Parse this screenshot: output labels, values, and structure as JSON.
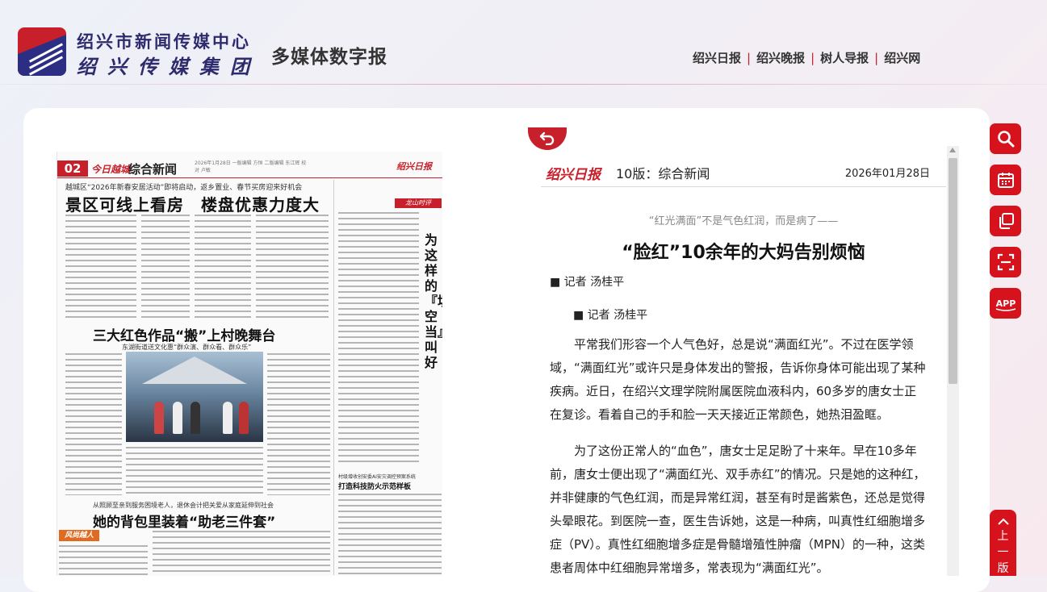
{
  "header": {
    "org_name": "绍兴市新闻传媒中心",
    "org_group": "绍兴传媒集团",
    "site_title": "多媒体数字报",
    "nav": [
      "绍兴日报",
      "绍兴晚报",
      "树人导报",
      "绍兴网"
    ],
    "nav_separator": "|"
  },
  "newspaper": {
    "page_number": "02",
    "brand": "今日越城",
    "section": "综合新闻",
    "meta": "2026年1月28日 一版编辑 方恒 二版编辑 东江辉 校对 卢敏",
    "masthead": "绍兴日报",
    "kicker1": "越城区“2026年新春安居活动”即将启动，返乡置业、春节买房迎来好机会",
    "headline1": "景区可线上看房　楼盘优惠力度大",
    "headline2": "三大红色作品“搬”上村晚舞台",
    "subhead2": "东湖街道送文化惠“群众演、群众看、群众乐”",
    "kicker3": "从照顾至亲到服务困境老人，退休会计把关爱从家庭延伸到社会",
    "headline3": "她的背包里装着“助老三件套”",
    "tag3": "风尚越人",
    "commentary_tag": "龙山时评",
    "vertical_title": "为这样的『填空当』叫好",
    "right_kicker": "村级增收创安委AI安灾调控预案系统",
    "right_headline": "打造科技防火示范样板"
  },
  "article": {
    "paper_logo": "绍兴日报",
    "page_label": "10版：综合新闻",
    "date": "2026年01月28日",
    "intro": "“红光满面”不是气色红润，而是病了——",
    "title": "“脸红”10余年的大妈告别烦恼",
    "author_line": "■ 记者 汤桂平",
    "author_line_2": "■ 记者 汤桂平",
    "paragraphs": [
      "平常我们形容一个人气色好，总是说“满面红光”。不过在医学领域，“满面红光”或许只是身体发出的警报，告诉你身体可能出现了某种疾病。近日，在绍兴文理学院附属医院血液科内，60多岁的唐女士正在复诊。看着自己的手和脸一天天接近正常颜色，她热泪盈眶。",
      "为了这份正常人的“血色”，唐女士足足盼了十来年。早在10多年前，唐女士便出现了“满面红光、双手赤红”的情况。只是她的这种红，并非健康的气色红润，而是异常红润，甚至有时是酱紫色，还总是觉得头晕眼花。到医院一查，医生告诉她，这是一种病，叫真性红细胞增多症（PV）。真性红细胞增多症是骨髓增殖性肿瘤（MPN）的一种，这类患者周体中红细胞异常增多，常表现为“满面红光”。"
    ]
  },
  "tools": {
    "icons": [
      "search-icon",
      "calendar-icon",
      "copy-icon",
      "scan-icon",
      "app-icon"
    ],
    "app_label": "APP",
    "back_to_top": "上一版"
  },
  "colors": {
    "brand_red": "#d6121d",
    "brand_navy": "#2e2a6e"
  }
}
